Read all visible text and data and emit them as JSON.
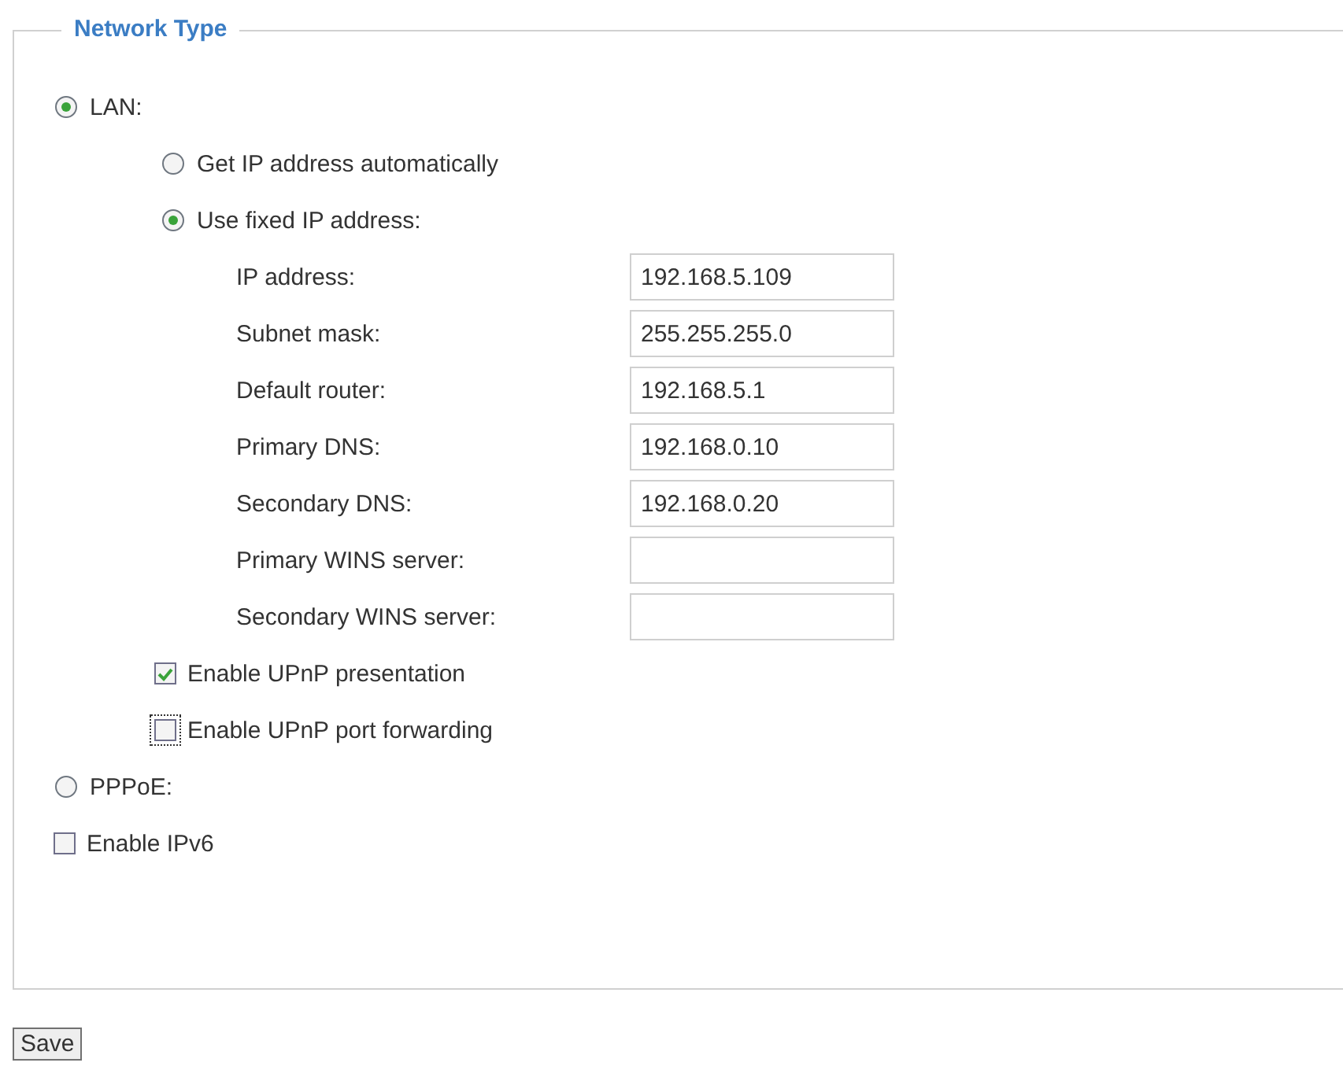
{
  "network_type": {
    "legend": "Network Type",
    "lan": {
      "label": "LAN:",
      "selected": true,
      "options": [
        {
          "label": "Get IP address automatically",
          "selected": false
        },
        {
          "label": "Use fixed IP address:",
          "selected": true
        }
      ],
      "fields": [
        {
          "label": "IP address:",
          "value": "192.168.5.109"
        },
        {
          "label": "Subnet mask:",
          "value": "255.255.255.0"
        },
        {
          "label": "Default router:",
          "value": "192.168.5.1"
        },
        {
          "label": "Primary DNS:",
          "value": "192.168.0.10"
        },
        {
          "label": "Secondary DNS:",
          "value": "192.168.0.20"
        },
        {
          "label": "Primary WINS server:"
        },
        {
          "label": "Secondary WINS server:"
        }
      ],
      "checkboxes": [
        {
          "label": "Enable UPnP presentation",
          "checked": true,
          "focused": false
        },
        {
          "label": "Enable UPnP port forwarding",
          "checked": false,
          "focused": true
        }
      ]
    },
    "pppoe": {
      "label": "PPPoE:",
      "selected": false
    },
    "ipv6": {
      "label": "Enable IPv6",
      "checked": false
    }
  },
  "save_button": "Save"
}
